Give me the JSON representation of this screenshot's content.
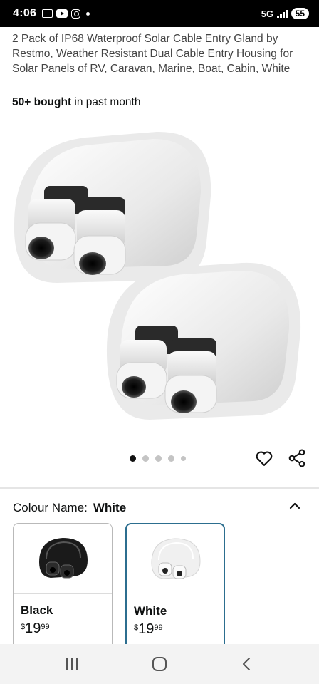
{
  "status_bar": {
    "time": "4:06",
    "network": "5G",
    "battery": "55"
  },
  "product": {
    "title": "2 Pack of IP68 Waterproof Solar Cable Entry Gland by Restmo, Weather Resistant Dual Cable Entry Housing for Solar Panels of RV, Caravan, Marine, Boat, Cabin, White",
    "bought_count": "50+ bought",
    "bought_suffix": " in past month",
    "image_count": 5,
    "active_image": 1
  },
  "variation": {
    "label": "Colour Name:",
    "selected": "White",
    "options": [
      {
        "name": "Black",
        "currency": "$",
        "whole": "19",
        "fraction": "99",
        "color": "#1a1a1a"
      },
      {
        "name": "White",
        "currency": "$",
        "whole": "19",
        "fraction": "99",
        "color": "#f2f2f2"
      }
    ]
  },
  "icons": {
    "wishlist": "heart-icon",
    "share": "share-icon",
    "collapse": "chevron-up-icon"
  },
  "colors": {
    "selected_border": "#2c6e8f",
    "active_dot": "#111111",
    "inactive_dot": "#c4c4c4"
  }
}
